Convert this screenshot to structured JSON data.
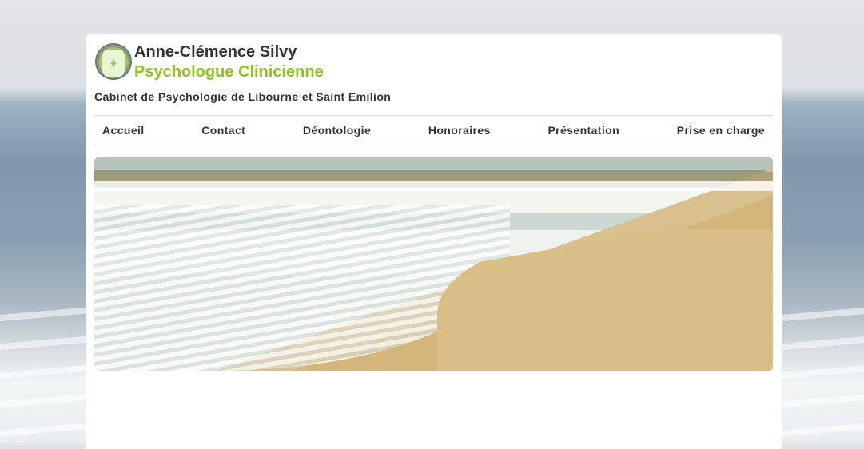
{
  "header": {
    "name": "Anne-Clémence Silvy",
    "profession": "Psychologue Clinicienne",
    "tagline": "Cabinet de Psychologie de Libourne et Saint Emilion"
  },
  "nav": {
    "items": [
      {
        "label": "Accueil"
      },
      {
        "label": "Contact"
      },
      {
        "label": "Déontologie"
      },
      {
        "label": "Honoraires"
      },
      {
        "label": "Présentation"
      },
      {
        "label": "Prise en charge"
      }
    ]
  },
  "colors": {
    "accent": "#8dc21f",
    "text": "#333333"
  },
  "icons": {
    "logo": "leaf-circle-logo"
  }
}
